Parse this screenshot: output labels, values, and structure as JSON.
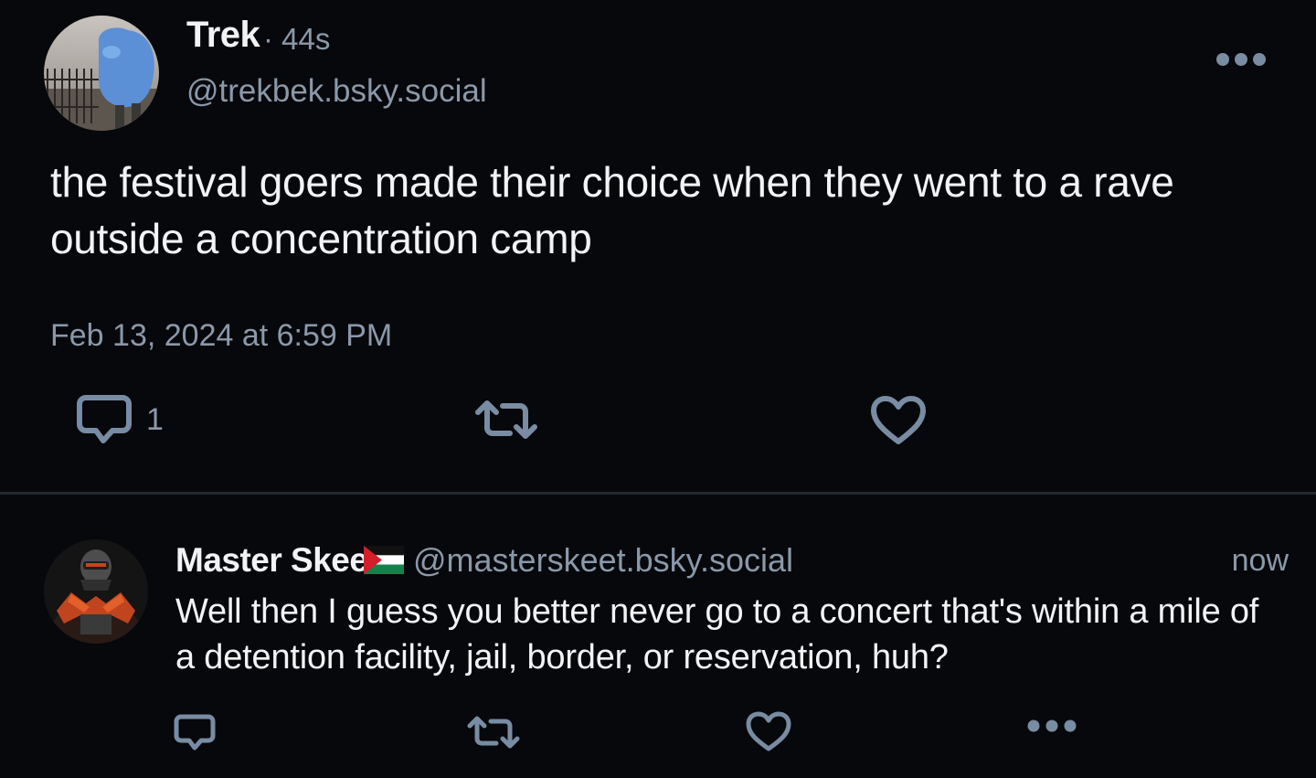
{
  "main_post": {
    "author": {
      "display_name": "Trek",
      "handle": "@trekbek.bsky.social",
      "age": "· 44s"
    },
    "text": "the festival goers made their choice when they went to a rave outside a concentration camp",
    "date": "Feb 13, 2024 at 6:59 PM",
    "reply_count": "1",
    "icons": {
      "more": "more-horizontal-icon",
      "reply": "speech-bubble-icon",
      "repost": "repost-arrows-icon",
      "like": "heart-outline-icon"
    }
  },
  "reply": {
    "author": {
      "display_name": "Master Skeet",
      "handle": "@masterskeet.bsky.social",
      "flag": "palestinian-flag-icon"
    },
    "time": "now",
    "text": "Well then I guess you better never go to a concert that's within a mile of a detention facility, jail, border, or reservation, huh?"
  },
  "colors": {
    "background": "#07080b",
    "primary_text": "#f1f3f5",
    "secondary_text": "#8a99aa",
    "icon": "#788ca3",
    "divider": "#232a33"
  }
}
